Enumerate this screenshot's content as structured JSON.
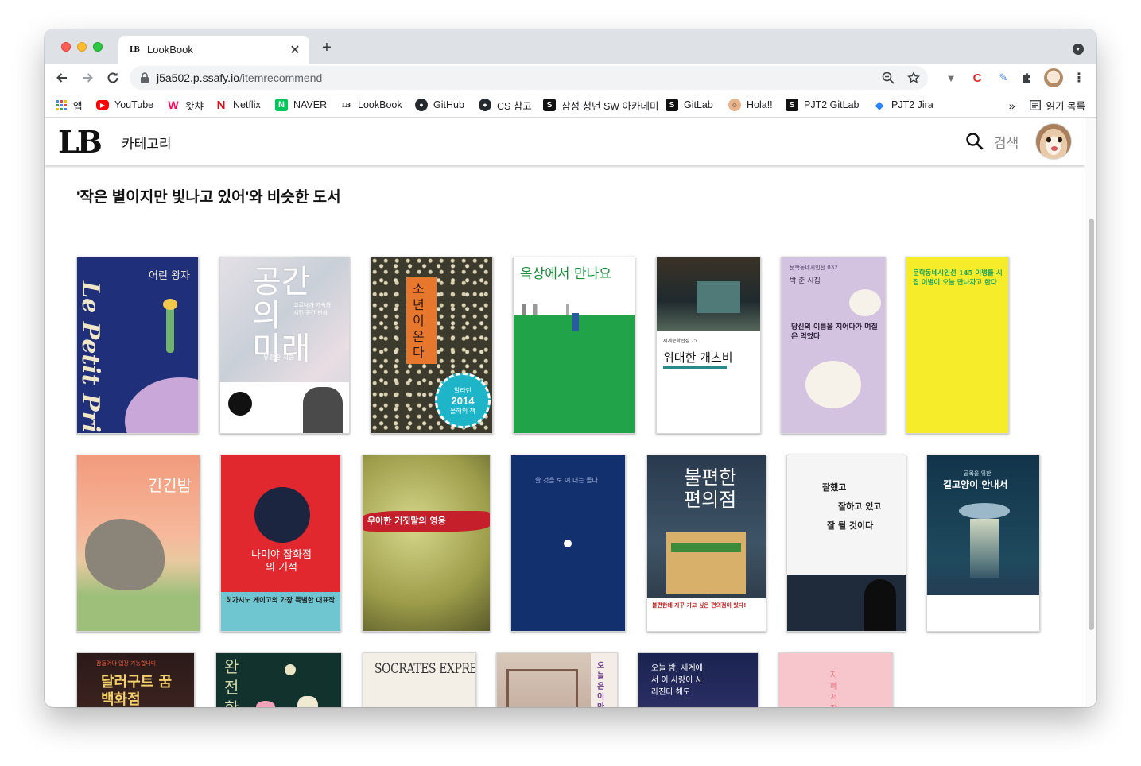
{
  "browser": {
    "tab_title": "LookBook",
    "tab_favicon": "LB",
    "url_host": "j5a502.p.ssafy.io",
    "url_path": "/itemrecommend",
    "bookmarks": [
      {
        "label": "앱",
        "icon": "apps-grid-icon"
      },
      {
        "label": "YouTube",
        "icon": "youtube-icon"
      },
      {
        "label": "왓챠",
        "icon": "watcha-icon"
      },
      {
        "label": "Netflix",
        "icon": "netflix-icon"
      },
      {
        "label": "NAVER",
        "icon": "naver-icon"
      },
      {
        "label": "LookBook",
        "icon": "lookbook-icon"
      },
      {
        "label": "GitHub",
        "icon": "github-icon"
      },
      {
        "label": "CS 참고",
        "icon": "github-icon"
      },
      {
        "label": "삼성 청년 SW 아카데미",
        "icon": "ssafy-icon"
      },
      {
        "label": "GitLab",
        "icon": "ssafy-icon"
      },
      {
        "label": "Hola!!",
        "icon": "hola-icon"
      },
      {
        "label": "PJT2 GitLab",
        "icon": "ssafy-icon"
      },
      {
        "label": "PJT2 Jira",
        "icon": "jira-icon"
      }
    ],
    "reading_list": "읽기 목록",
    "more_bookmarks": "»"
  },
  "header": {
    "logo": "LB",
    "category": "카테고리",
    "search_label": "검색"
  },
  "main": {
    "section_title": "'작은 별이지만 빛나고 있어'와 비슷한 도서"
  },
  "books": {
    "b1": {
      "title": "어린 왕자",
      "script": "Le Petit Prince"
    },
    "b2": {
      "title": "공간의 미래",
      "sub": "코로나가 가속화시킨 공간 변화",
      "author": "유현준 지음"
    },
    "b3": {
      "title": "소년이 온다",
      "badge_top": "알라딘",
      "badge_year": "2014",
      "badge_bottom": "올해의 책"
    },
    "b4": {
      "title": "옥상에서 만나요"
    },
    "b5": {
      "series": "세계문학전집 75",
      "title": "위대한 개츠비"
    },
    "b6": {
      "series": "문학동네시인선 032",
      "author": "박 준 시집",
      "title": "당신의 이름을 지어다가 며칠은 먹었다"
    },
    "b7": {
      "title": "문학동네시인선 145 이병률 시집 이별이 오늘 만나자고 한다"
    },
    "b8": {
      "title": "긴긴밤"
    },
    "b9": {
      "title": "나미야 잡화점의 기적",
      "banner": "히가시노 게이고의 가장 특별한 대표작"
    },
    "b10": {
      "title": "우아한 거짓말의 영웅"
    },
    "b11": {
      "title": "쓸 것을 토 여 너는 돌다"
    },
    "b12": {
      "title": "불편한 편의점",
      "caption": "불편한데 자꾸 가고 싶은 편의점이 있다!"
    },
    "b13": {
      "line1": "잘했고",
      "line2": "잘하고 있고",
      "line3": "잘 될 것이다"
    },
    "b14": {
      "title": "길고양이 안내서",
      "sub": "골목을 위한"
    },
    "b15": {
      "title": "달러구트 꿈 백화점",
      "top": "잠들어야 입장 가능합니다"
    },
    "b16": {
      "title": "완전한 행복"
    },
    "b17": {
      "title": "SOCRATES EXPRESS"
    },
    "b18": {
      "title": "오늘은 이만 좀 쉴게요"
    },
    "b19": {
      "title": "오늘 밤, 세계에서 이 사랑이 사라진다 해도"
    },
    "b20": {
      "title": "지혜서 잠"
    }
  },
  "colors": {
    "accent_chrome": "#dee1e6",
    "omnibox_bg": "#f1f3f4",
    "title_text": "#111111"
  }
}
